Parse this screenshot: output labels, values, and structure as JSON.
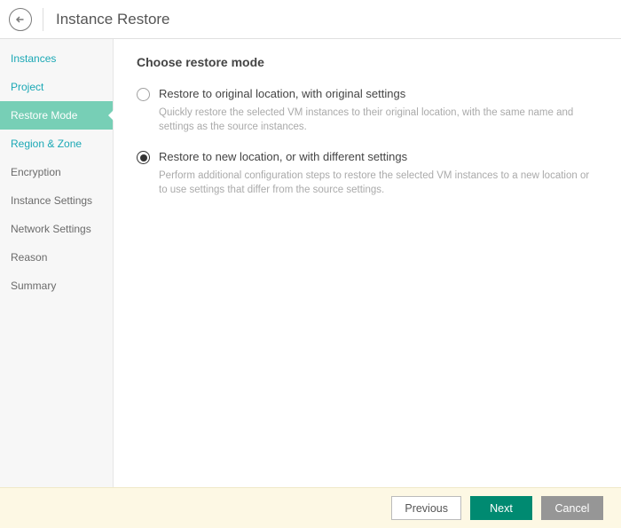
{
  "header": {
    "title": "Instance Restore"
  },
  "sidebar": {
    "items": [
      {
        "label": "Instances",
        "state": "completed"
      },
      {
        "label": "Project",
        "state": "completed"
      },
      {
        "label": "Restore Mode",
        "state": "active"
      },
      {
        "label": "Region & Zone",
        "state": "next"
      },
      {
        "label": "Encryption",
        "state": "pending"
      },
      {
        "label": "Instance Settings",
        "state": "pending"
      },
      {
        "label": "Network Settings",
        "state": "pending"
      },
      {
        "label": "Reason",
        "state": "pending"
      },
      {
        "label": "Summary",
        "state": "pending"
      }
    ]
  },
  "main": {
    "title": "Choose restore mode",
    "options": [
      {
        "label": "Restore to original location, with original settings",
        "desc": "Quickly restore the selected VM instances to their original location, with the same name and settings as the source instances.",
        "selected": false
      },
      {
        "label": "Restore to new location, or with different settings",
        "desc": "Perform additional configuration steps to restore the selected VM instances to a new location or to use settings that differ from the source settings.",
        "selected": true
      }
    ]
  },
  "footer": {
    "previous": "Previous",
    "next": "Next",
    "cancel": "Cancel"
  }
}
